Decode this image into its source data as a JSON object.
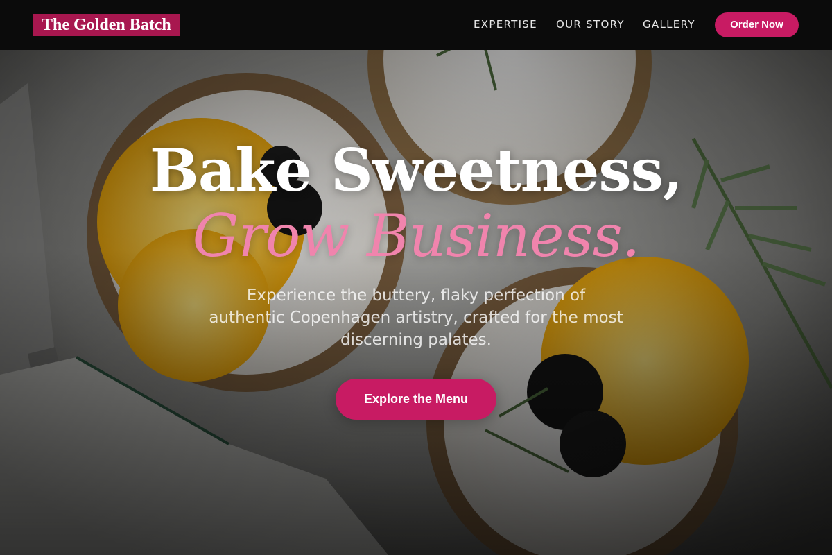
{
  "brand": {
    "name": "The Golden Batch",
    "accent": "#c81b63"
  },
  "nav": {
    "items": [
      {
        "label": "EXPERTISE"
      },
      {
        "label": "OUR STORY"
      },
      {
        "label": "GALLERY"
      }
    ],
    "order_label": "Order Now"
  },
  "hero": {
    "headline_line1": "Bake Sweetness,",
    "headline_line2": "Grow Business.",
    "headline_line2_color": "#f084ad",
    "subtitle": "Experience the buttery, flaky perfection of authentic Copenhagen artistry, crafted for the most discerning palates.",
    "cta_label": "Explore the Menu"
  }
}
